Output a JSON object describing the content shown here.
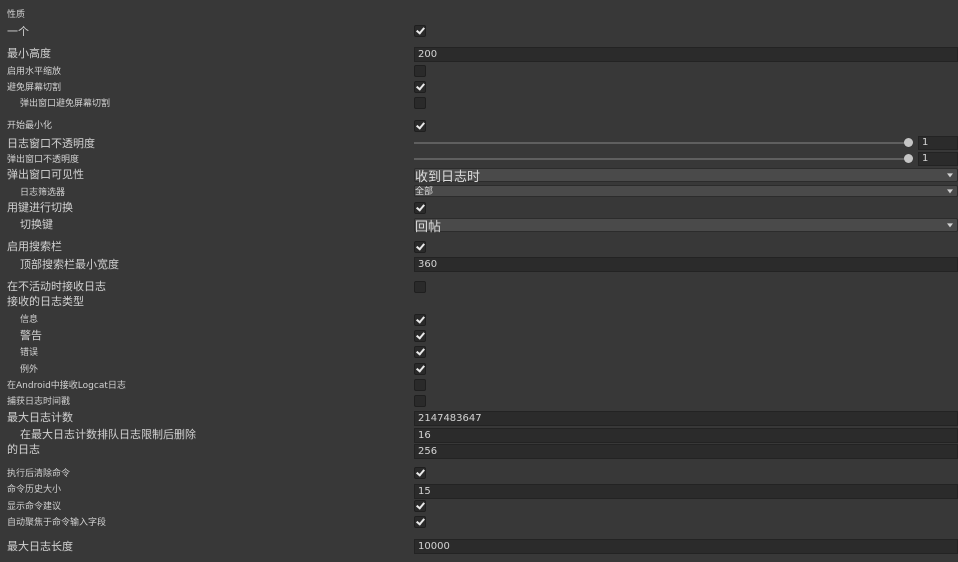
{
  "section_title": "性质",
  "rows": {
    "one": {
      "label": "一个",
      "checked": true
    },
    "min_height": {
      "label": "最小高度",
      "value": "200"
    },
    "enable_h_scale": {
      "label": "启用水平缩放",
      "checked": false
    },
    "avoid_cutout": {
      "label": "避免屏幕切割",
      "checked": true
    },
    "popup_avoid_cutout": {
      "label": "弹出窗口避免屏幕切割",
      "checked": false
    },
    "start_minimized": {
      "label": "开始最小化",
      "checked": true
    },
    "log_opacity": {
      "label": "日志窗口不透明度",
      "value": "1"
    },
    "popup_opacity": {
      "label": "弹出窗口不透明度",
      "value": "1"
    },
    "popup_visibility": {
      "label": "弹出窗口可见性",
      "value": "收到日志时"
    },
    "log_filter": {
      "label": "日志筛选器",
      "value": "全部"
    },
    "toggle_with_key": {
      "label": "用键进行切换",
      "checked": true
    },
    "toggle_key": {
      "label": "切换键",
      "value": "回帖"
    },
    "enable_search": {
      "label": "启用搜索栏",
      "checked": true
    },
    "search_min_width": {
      "label": "顶部搜索栏最小宽度",
      "value": "360"
    },
    "receive_inactive": {
      "label": "在不活动时接收日志",
      "checked": false
    },
    "received_types": {
      "label": "接收的日志类型"
    },
    "info": {
      "label": "信息",
      "checked": true
    },
    "warning": {
      "label": "警告",
      "checked": true
    },
    "error": {
      "label": "错误",
      "checked": true
    },
    "exception": {
      "label": "例外",
      "checked": true
    },
    "android_logcat": {
      "label": "在Android中接收Logcat日志",
      "checked": false
    },
    "capture_timestamps": {
      "label": "捕获日志时间戳",
      "checked": false
    },
    "max_log_count": {
      "label": "最大日志计数",
      "value": "2147483647"
    },
    "delete_after_limit": {
      "label": "在最大日志计数排队日志限制后删除",
      "value": "16"
    },
    "delete_logs": {
      "label": "的日志",
      "value": "256"
    },
    "clear_after_exec": {
      "label": "执行后清除命令",
      "checked": true
    },
    "cmd_history_size": {
      "label": "命令历史大小",
      "value": "15"
    },
    "show_cmd_suggest": {
      "label": "显示命令建议",
      "checked": true
    },
    "autofocus_cmd": {
      "label": "自动聚焦于命令输入字段",
      "checked": true
    },
    "max_log_length": {
      "label": "最大日志长度",
      "value": "10000"
    }
  }
}
